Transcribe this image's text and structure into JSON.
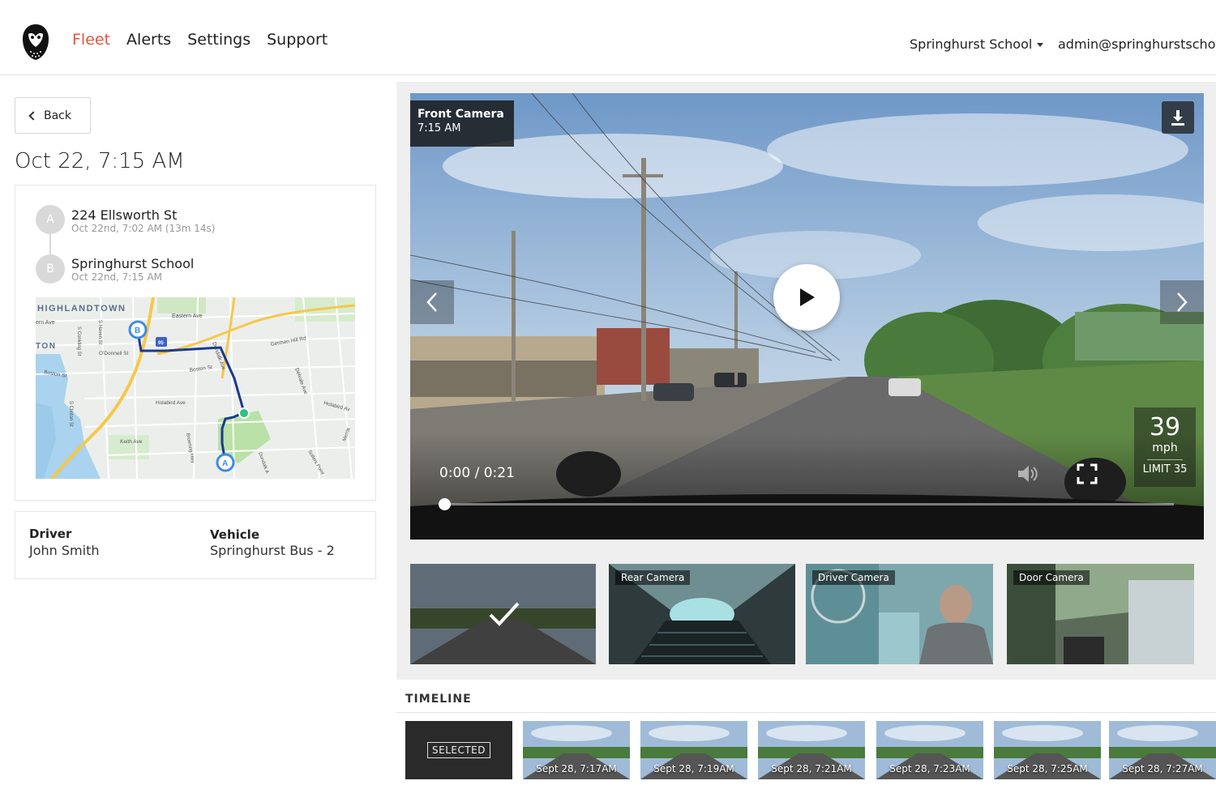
{
  "header": {
    "nav": [
      "Fleet",
      "Alerts",
      "Settings",
      "Support"
    ],
    "active_nav": "Fleet",
    "org_name": "Springhurst School",
    "user_email": "admin@springhurstschool"
  },
  "trip": {
    "back_label": "Back",
    "title": "Oct 22, 7:15 AM",
    "stops": [
      {
        "badge": "A",
        "name": "224 Ellsworth St",
        "time": "Oct 22nd, 7:02 AM (13m 14s)"
      },
      {
        "badge": "B",
        "name": "Springhurst School",
        "time": "Oct 22nd, 7:15 AM"
      }
    ],
    "map_labels": [
      "HIGHLANDTOWN",
      "Eastern Ave",
      "ern Ave",
      "S Haven St",
      "S Conkling St",
      "O'Donnell St",
      "TON",
      "German Hill Rd",
      "Boston St",
      "Boston St",
      "Dundalk Ave",
      "Delvale Ave",
      "Holabird Ave",
      "Holabird Av",
      "S Clinton St",
      "Keith Ave",
      "Broening Hwy",
      "Dundalk A",
      "Sollers Point",
      "Merritt",
      "95"
    ],
    "driver_label": "Driver",
    "driver_name": "John Smith",
    "vehicle_label": "Vehicle",
    "vehicle_name": "Springhurst Bus - 2"
  },
  "player": {
    "camera_name": "Front Camera",
    "camera_time": "7:15 AM",
    "time_display": "0:00 / 0:21",
    "progress_fraction": 0,
    "speed": "39",
    "speed_unit": "mph",
    "speed_limit": "LIMIT 35"
  },
  "cameras": [
    {
      "label": "",
      "selected": true
    },
    {
      "label": "Rear Camera",
      "selected": false
    },
    {
      "label": "Driver Camera",
      "selected": false
    },
    {
      "label": "Door Camera",
      "selected": false
    }
  ],
  "timeline": {
    "heading": "TIMELINE",
    "selected_label": "SELECTED",
    "items": [
      "Sept 28, 7:17AM",
      "Sept 28, 7:19AM",
      "Sept 28, 7:21AM",
      "Sept 28, 7:23AM",
      "Sept 28, 7:25AM",
      "Sept 28, 7:27AM"
    ]
  },
  "colors": {
    "accent": "#e8553a",
    "route_blue": "#1a3a8f",
    "marker_blue": "#3d8be8",
    "marker_green": "#2ec27e"
  },
  "icons": {
    "logo": "owl-logo-icon",
    "play": "play-icon",
    "download": "download-icon",
    "volume": "volume-icon",
    "fullscreen": "fullscreen-icon",
    "check": "check-icon"
  }
}
